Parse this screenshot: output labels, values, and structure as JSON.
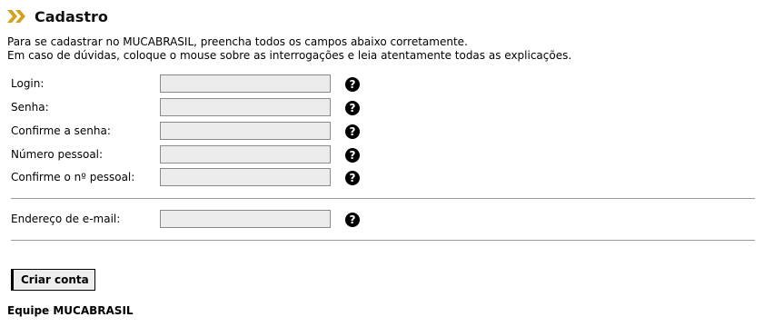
{
  "header": {
    "title": "Cadastro",
    "accent_color": "#d4a21a"
  },
  "intro": {
    "line1": "Para se cadastrar no MUCABRASIL, preencha todos os campos abaixo corretamente.",
    "line2": "Em caso de dúvidas, coloque o mouse sobre as interrogações e leia atentamente todas as explicações."
  },
  "form": {
    "fields": [
      {
        "label": "Login:",
        "value": "",
        "help_icon": "question-circle-icon"
      },
      {
        "label": "Senha:",
        "value": "",
        "help_icon": "question-circle-icon"
      },
      {
        "label": "Confirme a senha:",
        "value": "",
        "help_icon": "question-circle-icon"
      },
      {
        "label": "Número pessoal:",
        "value": "",
        "help_icon": "question-circle-icon"
      },
      {
        "label": "Confirme o nº pessoal:",
        "value": "",
        "help_icon": "question-circle-icon"
      }
    ],
    "email": {
      "label": "Endereço de e-mail:",
      "value": "",
      "help_icon": "question-circle-icon"
    },
    "help_glyph": "?",
    "submit_label": "Criar conta"
  },
  "footer": {
    "signature": "Equipe MUCABRASIL"
  }
}
